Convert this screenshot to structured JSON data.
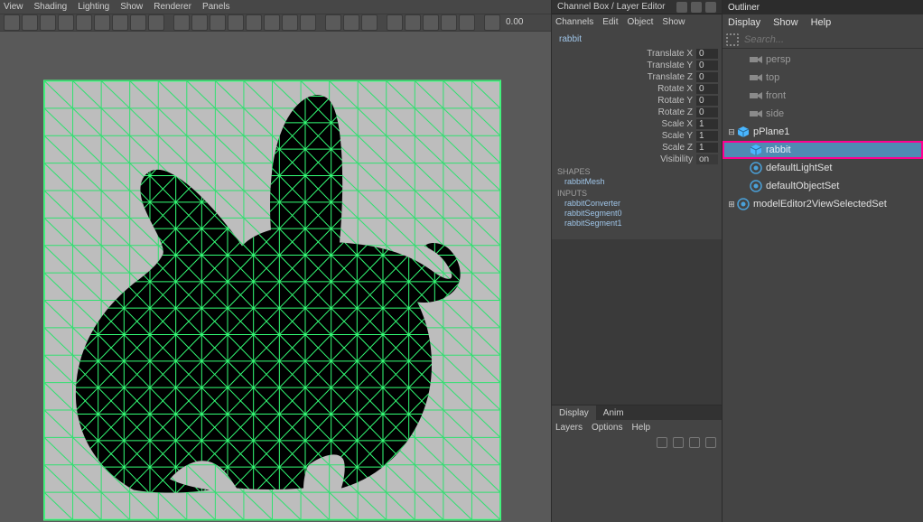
{
  "viewport": {
    "menu": [
      "View",
      "Shading",
      "Lighting",
      "Show",
      "Renderer",
      "Panels"
    ],
    "frame_value": "0.00"
  },
  "channelbox": {
    "tab_label": "Channel Box / Layer Editor",
    "menu": [
      "Channels",
      "Edit",
      "Object",
      "Show"
    ],
    "selected": "rabbit",
    "attrs": [
      {
        "label": "Translate X",
        "value": "0"
      },
      {
        "label": "Translate Y",
        "value": "0"
      },
      {
        "label": "Translate Z",
        "value": "0"
      },
      {
        "label": "Rotate X",
        "value": "0"
      },
      {
        "label": "Rotate Y",
        "value": "0"
      },
      {
        "label": "Rotate Z",
        "value": "0"
      },
      {
        "label": "Scale X",
        "value": "1"
      },
      {
        "label": "Scale Y",
        "value": "1"
      },
      {
        "label": "Scale Z",
        "value": "1"
      },
      {
        "label": "Visibility",
        "value": "on"
      }
    ],
    "sections": {
      "shapes_label": "SHAPES",
      "shapes": [
        "rabbitMesh"
      ],
      "inputs_label": "INPUTS",
      "inputs": [
        "rabbitConverter",
        "rabbitSegment0",
        "rabbitSegment1"
      ]
    },
    "bottom": {
      "tabs": [
        "Display",
        "Anim"
      ],
      "active_tab": 0,
      "menu": [
        "Layers",
        "Options",
        "Help"
      ]
    }
  },
  "outliner": {
    "tab_label": "Outliner",
    "menu": [
      "Display",
      "Show",
      "Help"
    ],
    "search_placeholder": "Search...",
    "nodes": [
      {
        "name": "persp",
        "type": "cam",
        "depth": 1
      },
      {
        "name": "top",
        "type": "cam",
        "depth": 1
      },
      {
        "name": "front",
        "type": "cam",
        "depth": 1
      },
      {
        "name": "side",
        "type": "cam",
        "depth": 1
      },
      {
        "name": "pPlane1",
        "type": "mesh",
        "depth": 0,
        "twisty": "minus",
        "bright": true
      },
      {
        "name": "rabbit",
        "type": "mesh",
        "depth": 1,
        "bright": true,
        "selected": true,
        "hilite": true
      },
      {
        "name": "defaultLightSet",
        "type": "set",
        "depth": 1,
        "bright": true
      },
      {
        "name": "defaultObjectSet",
        "type": "set",
        "depth": 1,
        "bright": true
      },
      {
        "name": "modelEditor2ViewSelectedSet",
        "type": "set",
        "depth": 0,
        "twisty": "plus",
        "bright": true
      }
    ]
  }
}
